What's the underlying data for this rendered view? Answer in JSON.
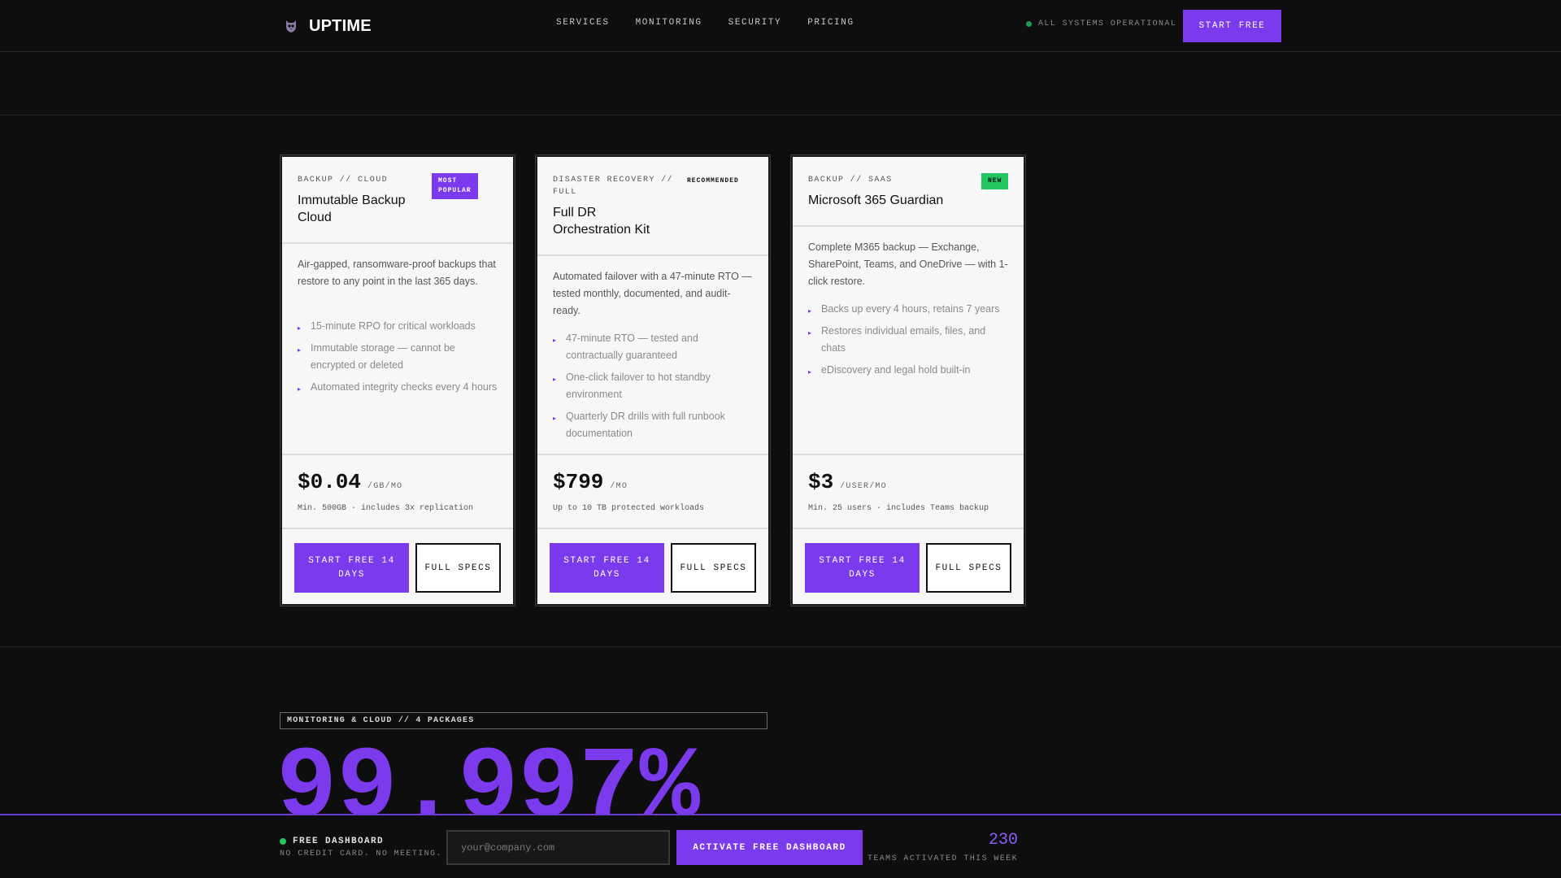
{
  "header": {
    "logo_text": "UPTIME",
    "nav": [
      "SERVICES",
      "MONITORING",
      "SECURITY",
      "PRICING"
    ],
    "status_text": "ALL SYSTEMS OPERATIONAL",
    "cta_label": "START FREE"
  },
  "colors": {
    "accent": "#7c3aed",
    "status_green": "#1f9d55",
    "badge_green": "#22c55e",
    "background": "#0e0e0f",
    "card_bg": "#f7f7f8"
  },
  "cards": [
    {
      "eyebrow": "BACKUP // CLOUD",
      "title_line1": "Immutable Backup",
      "title_line2": "Cloud",
      "badge_line1": "MOST",
      "badge_line2": "POPULAR",
      "description": "Air-gapped, ransomware-proof backups that restore to any point in the last 365 days.",
      "features": [
        "15-minute RPO for critical workloads",
        "Immutable storage — cannot be encrypted or deleted",
        "Automated integrity checks every 4 hours"
      ],
      "price": "$0.04",
      "price_unit": "/GB/MO",
      "price_note": "Min. 500GB · includes 3x replication",
      "primary_label": "START FREE 14 DAYS",
      "secondary_label": "FULL SPECS"
    },
    {
      "eyebrow_line1": "DISASTER RECOVERY //",
      "eyebrow_line2": "FULL",
      "title_line1": "Full DR",
      "title_line2": "Orchestration Kit",
      "badge": "RECOMMENDED",
      "description": "Automated failover with a 47-minute RTO — tested monthly, documented, and audit-ready.",
      "features": [
        "47-minute RTO — tested and contractually guaranteed",
        "One-click failover to hot standby environment",
        "Quarterly DR drills with full runbook documentation"
      ],
      "price": "$799",
      "price_unit": "/MO",
      "price_note": "Up to 10 TB protected workloads",
      "primary_label": "START FREE 14 DAYS",
      "secondary_label": "FULL SPECS"
    },
    {
      "eyebrow": "BACKUP // SAAS",
      "title_line1": "Microsoft 365 Guardian",
      "badge": "NEW",
      "description": "Complete M365 backup — Exchange, SharePoint, Teams, and OneDrive — with 1-click restore.",
      "features": [
        "Backs up every 4 hours, retains 7 years",
        "Restores individual emails, files, and chats",
        "eDiscovery and legal hold built-in"
      ],
      "price": "$3",
      "price_unit": "/USER/MO",
      "price_note": "Min. 25 users · includes Teams backup",
      "primary_label": "START FREE 14 DAYS",
      "secondary_label": "FULL SPECS"
    }
  ],
  "monitoring": {
    "tag": "MONITORING & CLOUD // 4 PACKAGES",
    "stat": "99.997%"
  },
  "bottom_bar": {
    "label": "FREE DASHBOARD",
    "sub": "NO CREDIT CARD. NO MEETING.",
    "email_placeholder": "your@company.com",
    "email_value": "",
    "cta_label": "ACTIVATE FREE DASHBOARD",
    "teams_count": "230",
    "teams_label": "TEAMS ACTIVATED THIS WEEK"
  }
}
